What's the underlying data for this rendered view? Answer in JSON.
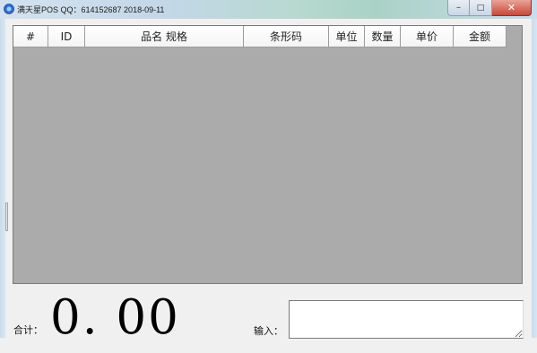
{
  "window": {
    "title": "满天星POS  QQ：614152687  2018-09-11",
    "minimize_glyph": "–",
    "maximize_glyph": "□",
    "close_glyph": "✕"
  },
  "grid": {
    "columns": [
      "#",
      "ID",
      "品名 规格",
      "条形码",
      "单位",
      "数量",
      "单价",
      "金额"
    ],
    "rows": []
  },
  "footer": {
    "total_label": "合计：",
    "total_value": "0. 00",
    "input_label": "输入：",
    "input_value": ""
  },
  "colors": {
    "grid_background": "#ababab",
    "window_background": "#f0f0f0",
    "close_button": "#c8483a"
  }
}
